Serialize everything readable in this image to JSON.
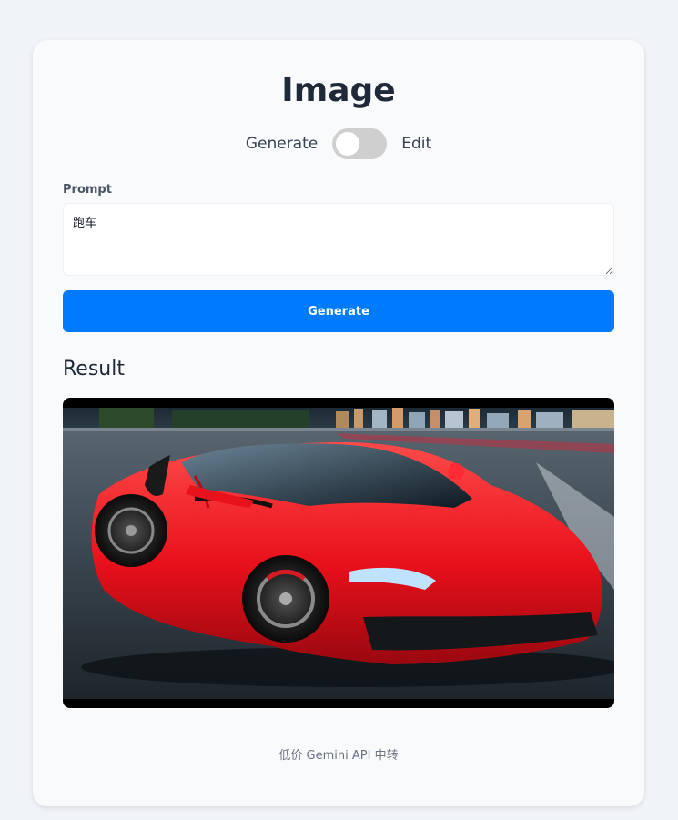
{
  "page": {
    "title": "Image"
  },
  "mode": {
    "left_label": "Generate",
    "right_label": "Edit",
    "selected": "Generate"
  },
  "prompt": {
    "label": "Prompt",
    "value": "跑车"
  },
  "generate_button": {
    "label": "Generate"
  },
  "result": {
    "heading": "Result"
  },
  "footer": {
    "text": "低价 Gemini API 中转"
  },
  "colors": {
    "primary_button": "#007bff",
    "toggle_off": "#cfcfcf",
    "page_background": "#f0f3f7",
    "card_background": "#f8fafc"
  }
}
